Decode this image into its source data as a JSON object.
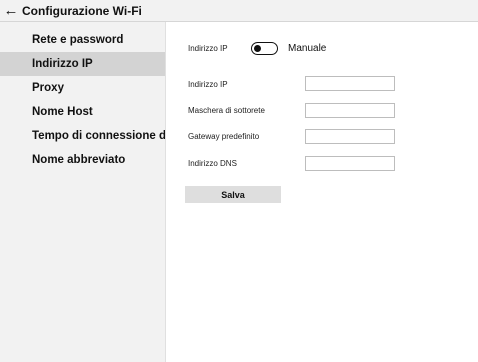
{
  "header": {
    "back_icon": "arrow-left-icon",
    "title": "Configurazione Wi-Fi"
  },
  "sidebar": {
    "items": [
      {
        "label": "Rete e password",
        "active": false
      },
      {
        "label": "Indirizzo IP",
        "active": true
      },
      {
        "label": "Proxy",
        "active": false
      },
      {
        "label": "Nome Host",
        "active": false
      },
      {
        "label": "Tempo di connessione dir",
        "active": false
      },
      {
        "label": "Nome abbreviato",
        "active": false
      }
    ]
  },
  "main": {
    "ip_mode": {
      "label": "Indirizzo IP",
      "toggle_on": false,
      "value_label": "Manuale"
    },
    "fields": [
      {
        "label": "Indirizzo IP",
        "value": ""
      },
      {
        "label": "Maschera di sottorete",
        "value": ""
      },
      {
        "label": "Gateway predefinito",
        "value": ""
      },
      {
        "label": "Indirizzo DNS",
        "value": ""
      }
    ],
    "save_label": "Salva"
  },
  "colors": {
    "sidebar_bg": "#f2f2f2",
    "active_item_bg": "#d3d3d3",
    "button_bg": "#dedede"
  }
}
